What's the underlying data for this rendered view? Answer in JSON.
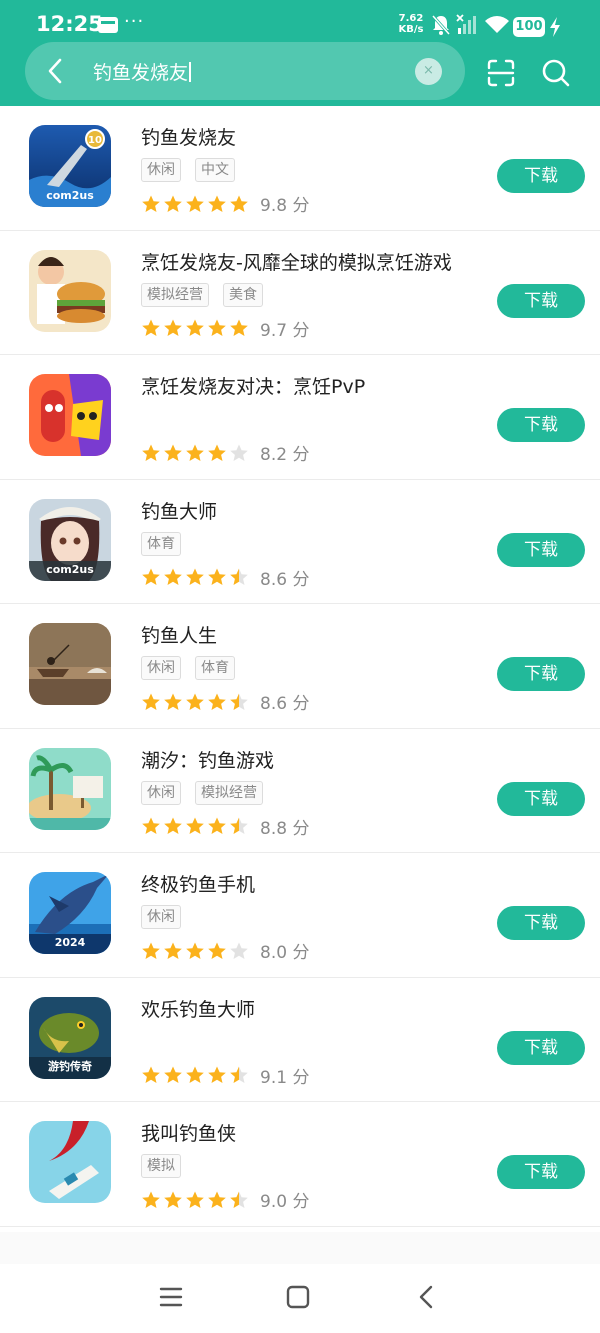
{
  "status_bar": {
    "time": "12:25",
    "dots": "···",
    "net_speed_value": "7.62",
    "net_speed_unit": "KB/s",
    "battery": "100"
  },
  "search": {
    "query": "钓鱼发烧友",
    "clear_label": "×"
  },
  "accent_color": "#22b99a",
  "star_color": "#fbb21c",
  "results": [
    {
      "name": "钓鱼发烧友",
      "tags": [
        "休闲",
        "中文"
      ],
      "rating": 5,
      "score": "9.8 分",
      "button": "下载",
      "icon": "fishing-game-icon",
      "icon_label": "com2us"
    },
    {
      "name": "烹饪发烧友-风靡全球的模拟烹饪游戏",
      "tags": [
        "模拟经营",
        "美食"
      ],
      "rating": 5,
      "score": "9.7 分",
      "button": "下载",
      "icon": "burger-chef-icon",
      "icon_label": ""
    },
    {
      "name": "烹饪发烧友对决：烹饪PvP",
      "tags": [],
      "rating": 4,
      "score": "8.2 分",
      "button": "下载",
      "icon": "sausage-cheese-icon",
      "icon_label": ""
    },
    {
      "name": "钓鱼大师",
      "tags": [
        "体育"
      ],
      "rating": 4.5,
      "score": "8.6 分",
      "button": "下载",
      "icon": "anime-girl-icon",
      "icon_label": "com2us"
    },
    {
      "name": "钓鱼人生",
      "tags": [
        "休闲",
        "体育"
      ],
      "rating": 4.5,
      "score": "8.6 分",
      "button": "下载",
      "icon": "fisherman-boat-icon",
      "icon_label": ""
    },
    {
      "name": "潮汐：钓鱼游戏",
      "tags": [
        "休闲",
        "模拟经营"
      ],
      "rating": 4.5,
      "score": "8.8 分",
      "button": "下载",
      "icon": "island-raft-icon",
      "icon_label": ""
    },
    {
      "name": "终极钓鱼手机",
      "tags": [
        "休闲"
      ],
      "rating": 4,
      "score": "8.0 分",
      "button": "下载",
      "icon": "marlin-icon",
      "icon_label": "2024"
    },
    {
      "name": "欢乐钓鱼大师",
      "tags": [],
      "rating": 4.5,
      "score": "9.1 分",
      "button": "下载",
      "icon": "bass-fish-icon",
      "icon_label": "游钓传奇"
    },
    {
      "name": "我叫钓鱼侠",
      "tags": [
        "模拟"
      ],
      "rating": 4.5,
      "score": "9.0 分",
      "button": "下载",
      "icon": "boat-shark-icon",
      "icon_label": ""
    }
  ]
}
